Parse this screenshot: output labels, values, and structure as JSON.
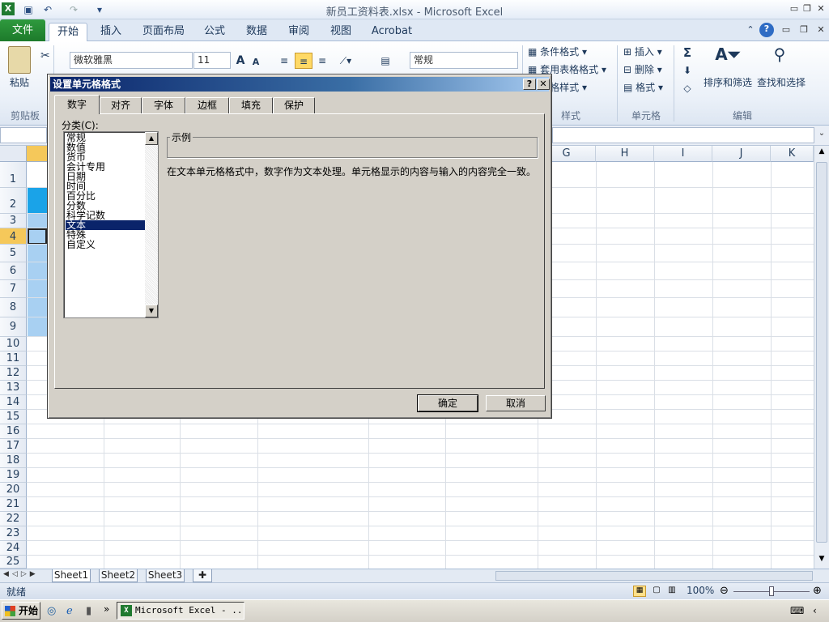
{
  "window": {
    "title": "新员工资料表.xlsx  -  Microsoft Excel"
  },
  "ribbon_tabs": [
    "文件",
    "开始",
    "插入",
    "页面布局",
    "公式",
    "数据",
    "审阅",
    "视图",
    "Acrobat"
  ],
  "ribbon": {
    "paste_label": "粘贴",
    "clipboard_group": "剪贴板",
    "font_name": "微软雅黑",
    "font_size": "11",
    "number_format": "常规",
    "conditional_format": "条件格式",
    "table_format": "套用表格格式",
    "cell_styles": "元格样式",
    "styles_group": "样式",
    "insert": "插入",
    "delete": "删除",
    "format": "格式",
    "cells_group": "单元格",
    "sort_filter": "排序和筛选",
    "find_select": "查找和选择",
    "editing_group": "编辑"
  },
  "grid": {
    "columns": [
      "G",
      "H",
      "I",
      "J",
      "K"
    ],
    "rows": [
      "1",
      "2",
      "3",
      "4",
      "5",
      "6",
      "7",
      "8",
      "9",
      "10",
      "11",
      "12",
      "13",
      "14",
      "15",
      "16",
      "17",
      "18",
      "19",
      "20",
      "21",
      "22",
      "23",
      "24",
      "25"
    ]
  },
  "sheet_tabs": [
    "Sheet1",
    "Sheet2",
    "Sheet3"
  ],
  "status": {
    "ready": "就绪",
    "zoom": "100%"
  },
  "taskbar": {
    "start": "开始",
    "task": "Microsoft Excel - ..."
  },
  "dialog": {
    "title": "设置单元格格式",
    "tabs": [
      "数字",
      "对齐",
      "字体",
      "边框",
      "填充",
      "保护"
    ],
    "category_label": "分类(C):",
    "categories": [
      "常规",
      "数值",
      "货币",
      "会计专用",
      "日期",
      "时间",
      "百分比",
      "分数",
      "科学记数",
      "文本",
      "特殊",
      "自定义"
    ],
    "selected_category": "文本",
    "sample_label": "示例",
    "description": "在文本单元格格式中，数字作为文本处理。单元格显示的内容与输入的内容完全一致。",
    "ok": "确定",
    "cancel": "取消"
  },
  "colors": {
    "accent": "#0a246a",
    "file_tab": "#1d7a2b",
    "selection": "#9ec9f0"
  }
}
